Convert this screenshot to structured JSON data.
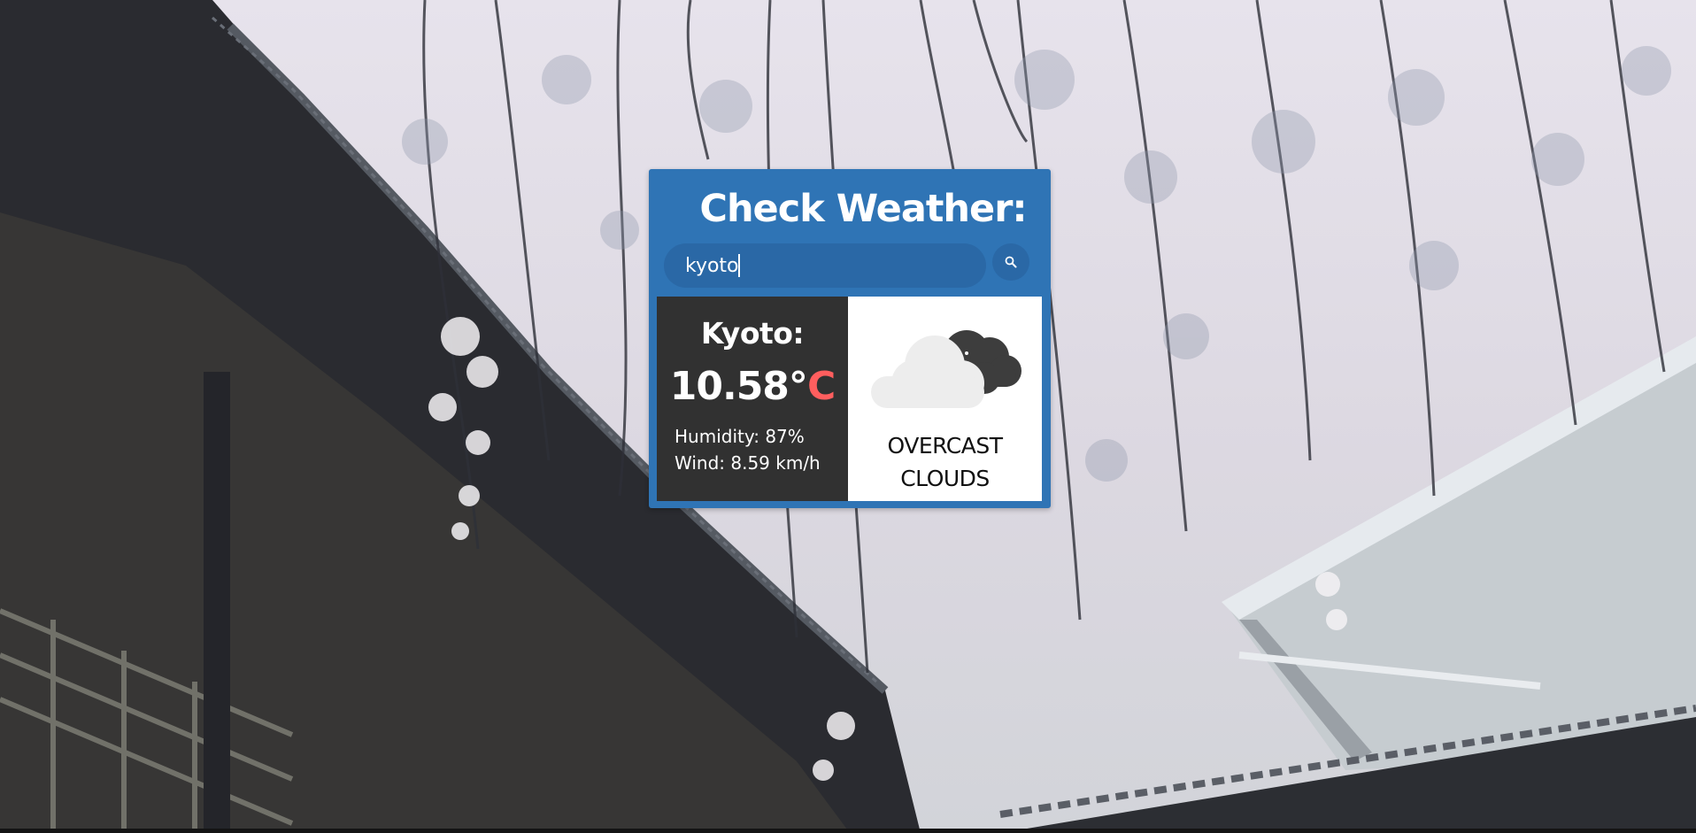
{
  "widget": {
    "title": "Check Weather:",
    "search": {
      "value": "kyoto",
      "icon": "search-icon"
    }
  },
  "result": {
    "city": "Kyoto:",
    "temperature_value": "10.58°",
    "temperature_unit": "C",
    "humidity": "Humidity: 87%",
    "wind": "Wind: 8.59 km/h",
    "condition": "OVERCAST CLOUDS",
    "condition_icon": "overcast-clouds-icon"
  },
  "colors": {
    "panel_blue": "#2f74b5",
    "dark_panel": "#313131",
    "unit_accent": "#ff5e5e"
  }
}
